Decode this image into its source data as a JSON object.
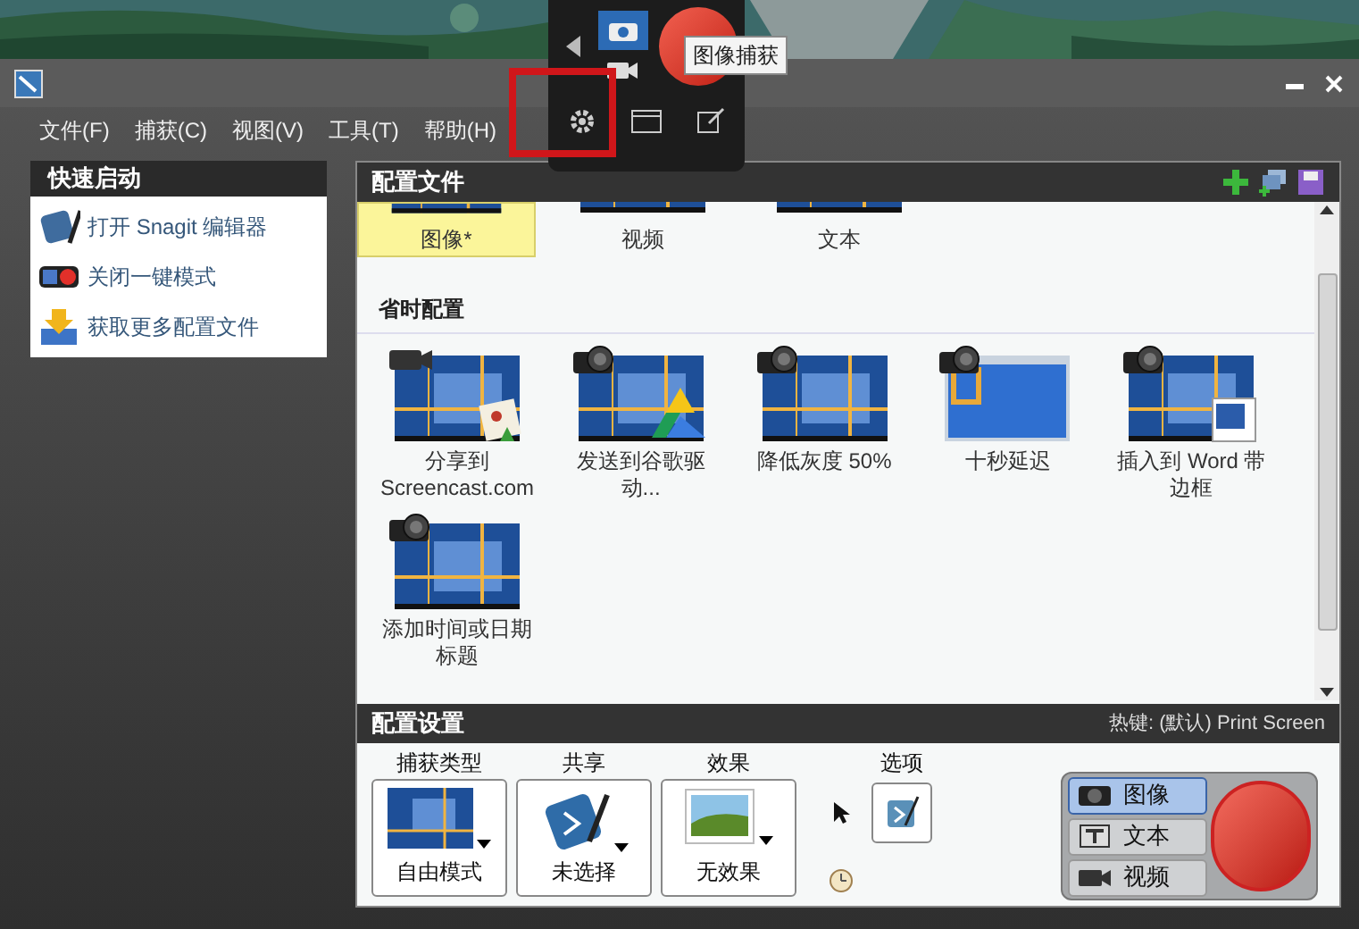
{
  "capture_widget": {
    "tooltip": "图像捕获"
  },
  "menu": [
    "文件(F)",
    "捕获(C)",
    "视图(V)",
    "工具(T)",
    "帮助(H)"
  ],
  "quick_launch": {
    "title": "快速启动",
    "items": [
      {
        "label": "打开 Snagit 编辑器",
        "kind": "editor"
      },
      {
        "label": "关闭一键模式",
        "kind": "toggle"
      },
      {
        "label": "获取更多配置文件",
        "kind": "download"
      }
    ]
  },
  "profiles": {
    "title": "配置文件",
    "top_items": [
      {
        "label": "图像*",
        "selected": true
      },
      {
        "label": "视频",
        "selected": false
      },
      {
        "label": "文本",
        "selected": false
      }
    ],
    "section_title": "省时配置",
    "items": [
      {
        "label": "分享到 Screencast.com",
        "kind": "video_share"
      },
      {
        "label": "发送到谷歌驱动...",
        "kind": "camera_drive"
      },
      {
        "label": "降低灰度 50%",
        "kind": "camera_plain"
      },
      {
        "label": "十秒延迟",
        "kind": "camera_window"
      },
      {
        "label": "插入到 Word 带边框",
        "kind": "camera_word"
      },
      {
        "label": "添加时间或日期标题",
        "kind": "camera_plain"
      }
    ]
  },
  "settings": {
    "title": "配置设置",
    "hotkey": "热键: (默认) Print Screen",
    "groups": [
      {
        "label": "捕获类型",
        "value": "自由模式",
        "kind": "region"
      },
      {
        "label": "共享",
        "value": "未选择",
        "kind": "share"
      },
      {
        "label": "效果",
        "value": "无效果",
        "kind": "effect"
      }
    ],
    "options_label": "选项",
    "modes": [
      {
        "label": "图像",
        "selected": true
      },
      {
        "label": "文本",
        "kind": "text",
        "selected": false
      },
      {
        "label": "视频",
        "kind": "video",
        "selected": false
      }
    ]
  }
}
